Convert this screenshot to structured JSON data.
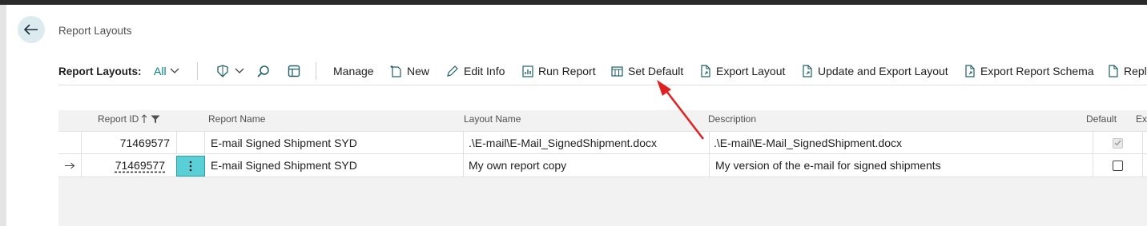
{
  "page": {
    "title": "Report Layouts"
  },
  "toolbar": {
    "view_label": "Report Layouts:",
    "filter_value": "All",
    "manage": "Manage",
    "new": "New",
    "edit_info": "Edit Info",
    "run_report": "Run Report",
    "set_default": "Set Default",
    "export_layout": "Export Layout",
    "update_export": "Update and Export Layout",
    "export_schema": "Export Report Schema",
    "replace": "Repla"
  },
  "columns": {
    "report_id": "Report ID",
    "report_name": "Report Name",
    "layout_name": "Layout Name",
    "description": "Description",
    "default": "Default",
    "ext": "Ext"
  },
  "rows": [
    {
      "report_id": "71469577",
      "report_name": "E-mail Signed Shipment SYD",
      "layout_name": ".\\E-mail\\E-Mail_SignedShipment.docx",
      "description": ".\\E-mail\\E-Mail_SignedShipment.docx",
      "default": true
    },
    {
      "report_id": "71469577",
      "report_name": "E-mail Signed Shipment SYD",
      "layout_name": "My own report copy",
      "description": "My version of the e-mail for signed shipments",
      "default": false
    }
  ],
  "annotation": {
    "arrow_color": "#e02020"
  },
  "colors": {
    "accent": "#00808a",
    "selected_action": "#5ad0d6"
  }
}
